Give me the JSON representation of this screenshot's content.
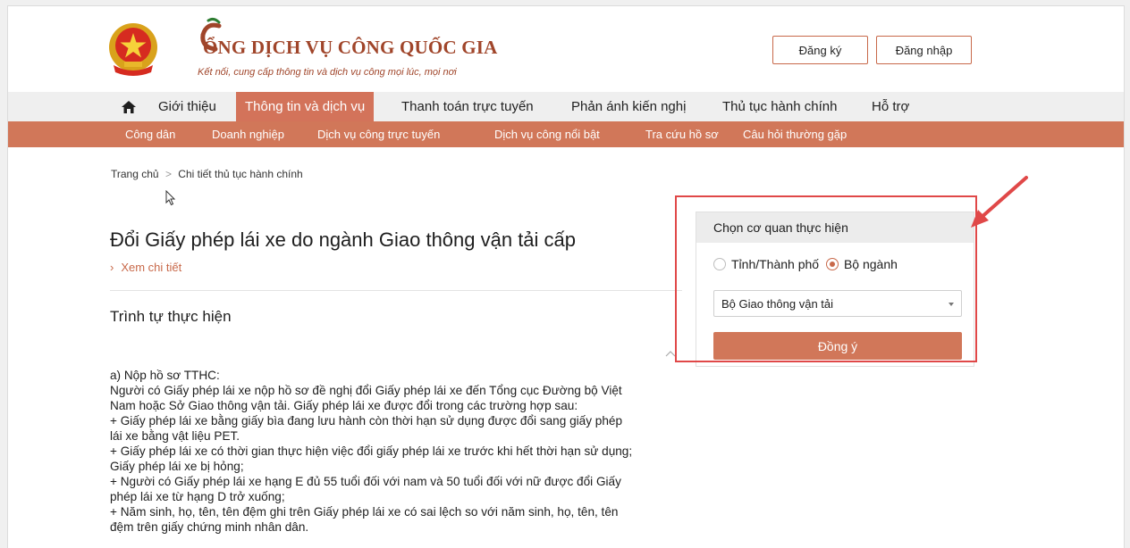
{
  "header": {
    "brand_title": "ỔNG DỊCH VỤ CÔNG QUỐC GIA",
    "brand_subtitle": "Kết nối, cung cấp thông tin và dịch vụ công mọi lúc, mọi nơi",
    "register_label": "Đăng ký",
    "login_label": "Đăng nhập"
  },
  "main_nav": {
    "items": [
      "Giới thiệu",
      "Thông tin và dịch vụ",
      "Thanh toán trực tuyến",
      "Phản ánh kiến nghị",
      "Thủ tục hành chính",
      "Hỗ trợ"
    ],
    "active": "Thông tin và dịch vụ"
  },
  "sub_nav": {
    "items": [
      "Công dân",
      "Doanh nghiệp",
      "Dịch vụ công trực tuyến",
      "Dịch vụ công nổi bật",
      "Tra cứu hồ sơ",
      "Câu hỏi thường gặp"
    ]
  },
  "breadcrumb": {
    "home": "Trang chủ",
    "separator": ">",
    "current": "Chi tiết thủ tục hành chính"
  },
  "procedure": {
    "title": "Đổi Giấy phép lái xe do ngành Giao thông vận tải cấp",
    "more_chevron": "›",
    "more_link": "Xem chi tiết",
    "section_title": "Trình tự thực hiện",
    "content_lines": [
      "a) Nộp hồ sơ TTHC:",
      "Người có Giấy phép lái xe nộp hồ sơ đề nghị đổi Giấy phép lái xe đến Tổng cục Đường bộ Việt",
      "Nam hoặc Sở Giao thông vận tải. Giấy phép lái xe được đổi trong các trường hợp sau:",
      "+ Giấy phép lái xe bằng giấy bìa đang lưu hành còn thời hạn sử dụng được đổi sang giấy phép",
      "lái xe bằng vật liệu PET.",
      "+ Giấy phép lái xe có thời gian thực hiện việc đổi giấy phép lái xe trước khi hết thời hạn sử dụng;",
      "Giấy phép lái xe bị hỏng;",
      "+ Người có Giấy phép lái xe hạng E đủ 55 tuổi đối với nam và 50 tuổi đối với nữ được đổi Giấy",
      "phép lái xe từ hạng D trở xuống;",
      "+ Năm sinh, họ, tên, tên đệm ghi trên Giấy phép lái xe có sai lệch so với năm sinh, họ, tên, tên",
      "đệm trên giấy chứng minh nhân dân."
    ]
  },
  "agency_panel": {
    "header": "Chọn cơ quan thực hiện",
    "option_province": "Tỉnh/Thành phố",
    "option_ministry": "Bộ ngành",
    "selected_option": "Bộ ngành",
    "select_value": "Bộ Giao thông vận tải",
    "agree_label": "Đồng ý"
  },
  "colors": {
    "brand": "#a0452a",
    "accent": "#d17759",
    "annotation": "#e04848"
  },
  "icons": [
    "home-icon",
    "emblem-icon",
    "chevron-down-icon",
    "chevron-up-icon",
    "cursor-icon",
    "annotation-arrow-icon"
  ]
}
